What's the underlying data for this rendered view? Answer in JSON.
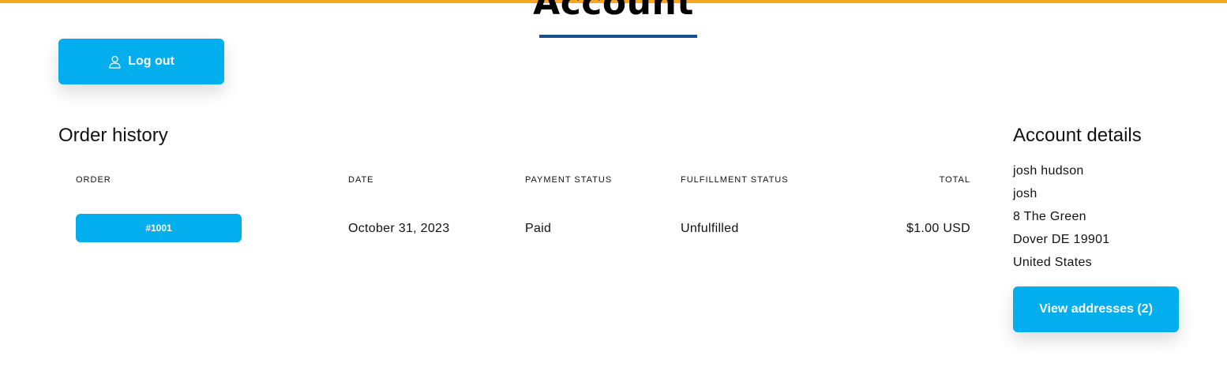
{
  "header": {
    "title": "Account",
    "accent_color": "#f5a623",
    "underline_color": "#1a4f8b"
  },
  "logout": {
    "label": "Log out",
    "icon": "user-icon"
  },
  "order_history": {
    "title": "Order history",
    "columns": {
      "order": "ORDER",
      "date": "DATE",
      "payment_status": "PAYMENT STATUS",
      "fulfillment_status": "FULFILLMENT STATUS",
      "total": "TOTAL"
    },
    "rows": [
      {
        "order": "#1001",
        "date": "October 31, 2023",
        "payment_status": "Paid",
        "fulfillment_status": "Unfulfilled",
        "total": "$1.00 USD"
      }
    ]
  },
  "account_details": {
    "title": "Account details",
    "lines": [
      "josh hudson",
      "josh",
      "8 The Green",
      "Dover DE 19901",
      "United States"
    ],
    "view_addresses_label": "View addresses (2)"
  },
  "colors": {
    "button_bg": "#03aeef",
    "text": "#121212"
  }
}
